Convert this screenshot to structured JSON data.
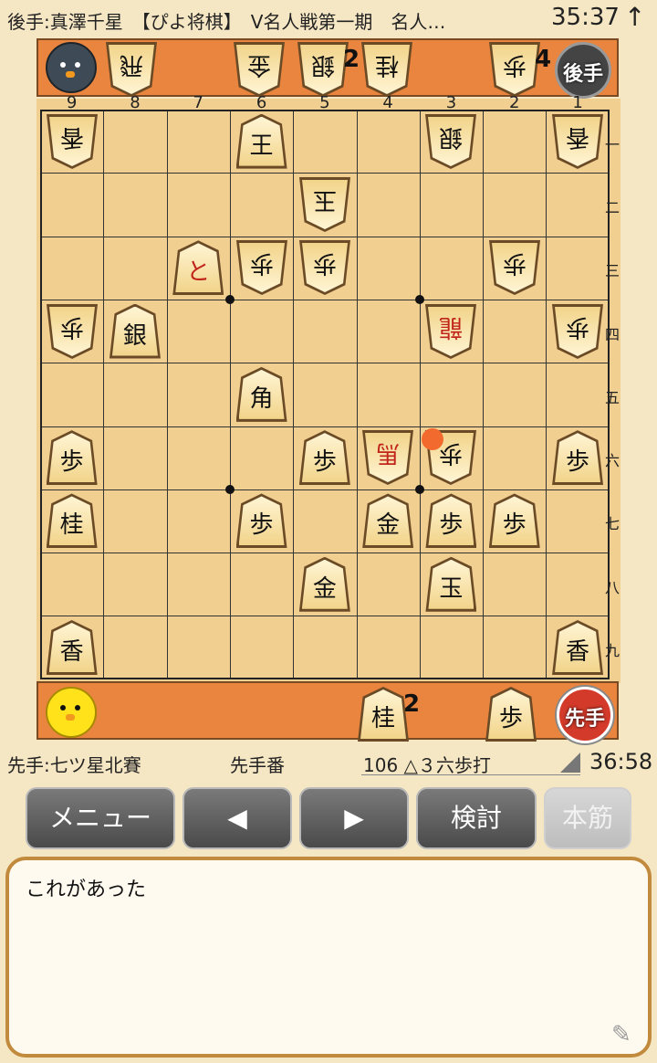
{
  "header": {
    "title": "後手:真澤千星　【ぴよ将棋】　V名人戦第一期　名人…",
    "clock": "35:37",
    "arrow": "↑"
  },
  "board": {
    "file_labels": [
      "9",
      "8",
      "7",
      "6",
      "5",
      "4",
      "3",
      "2",
      "1"
    ],
    "rank_labels": [
      "一",
      "二",
      "三",
      "四",
      "五",
      "六",
      "七",
      "八",
      "九"
    ],
    "pieces": [
      {
        "file": 9,
        "rank": 1,
        "glyph": "香",
        "owner": "gote"
      },
      {
        "file": 6,
        "rank": 1,
        "glyph": "王",
        "owner": "sente"
      },
      {
        "file": 3,
        "rank": 1,
        "glyph": "銀",
        "owner": "gote"
      },
      {
        "file": 1,
        "rank": 1,
        "glyph": "香",
        "owner": "gote"
      },
      {
        "file": 5,
        "rank": 2,
        "glyph": "玉",
        "owner": "gote"
      },
      {
        "file": 7,
        "rank": 3,
        "glyph": "と",
        "owner": "sente",
        "red": true
      },
      {
        "file": 6,
        "rank": 3,
        "glyph": "歩",
        "owner": "gote"
      },
      {
        "file": 5,
        "rank": 3,
        "glyph": "歩",
        "owner": "gote"
      },
      {
        "file": 2,
        "rank": 3,
        "glyph": "歩",
        "owner": "gote"
      },
      {
        "file": 9,
        "rank": 4,
        "glyph": "歩",
        "owner": "gote"
      },
      {
        "file": 8,
        "rank": 4,
        "glyph": "銀",
        "owner": "sente"
      },
      {
        "file": 3,
        "rank": 4,
        "glyph": "龍",
        "owner": "gote",
        "red": true
      },
      {
        "file": 1,
        "rank": 4,
        "glyph": "歩",
        "owner": "gote"
      },
      {
        "file": 6,
        "rank": 5,
        "glyph": "角",
        "owner": "sente"
      },
      {
        "file": 9,
        "rank": 6,
        "glyph": "歩",
        "owner": "sente"
      },
      {
        "file": 5,
        "rank": 6,
        "glyph": "歩",
        "owner": "sente"
      },
      {
        "file": 4,
        "rank": 6,
        "glyph": "馬",
        "owner": "gote",
        "red": true
      },
      {
        "file": 3,
        "rank": 6,
        "glyph": "歩",
        "owner": "gote"
      },
      {
        "file": 1,
        "rank": 6,
        "glyph": "歩",
        "owner": "sente"
      },
      {
        "file": 9,
        "rank": 7,
        "glyph": "桂",
        "owner": "sente"
      },
      {
        "file": 6,
        "rank": 7,
        "glyph": "歩",
        "owner": "sente"
      },
      {
        "file": 4,
        "rank": 7,
        "glyph": "金",
        "owner": "sente"
      },
      {
        "file": 3,
        "rank": 7,
        "glyph": "歩",
        "owner": "sente"
      },
      {
        "file": 2,
        "rank": 7,
        "glyph": "歩",
        "owner": "sente"
      },
      {
        "file": 5,
        "rank": 8,
        "glyph": "金",
        "owner": "sente"
      },
      {
        "file": 3,
        "rank": 8,
        "glyph": "玉",
        "owner": "sente"
      },
      {
        "file": 9,
        "rank": 9,
        "glyph": "香",
        "owner": "sente"
      },
      {
        "file": 1,
        "rank": 9,
        "glyph": "香",
        "owner": "sente"
      }
    ],
    "last_move_marker": {
      "file": 3,
      "rank": 6
    }
  },
  "gote_hand": {
    "label": "後手",
    "pieces": [
      {
        "glyph": "飛",
        "count": ""
      },
      {
        "glyph": "金",
        "count": ""
      },
      {
        "glyph": "銀",
        "count": "2"
      },
      {
        "glyph": "桂",
        "count": ""
      },
      {
        "glyph": "歩",
        "count": "4"
      }
    ]
  },
  "sente_hand": {
    "label": "先手",
    "pieces": [
      {
        "glyph": "桂",
        "count": "2"
      },
      {
        "glyph": "歩",
        "count": ""
      }
    ]
  },
  "info": {
    "player": "先手:七ツ星北賽",
    "turn": "先手番",
    "move": "106 △３六歩打",
    "time": "36:58"
  },
  "buttons": {
    "menu": "メニュー",
    "prev": "◀",
    "next": "▶",
    "analyze": "検討",
    "mainline": "本筋"
  },
  "comment": {
    "text": "これがあった"
  }
}
